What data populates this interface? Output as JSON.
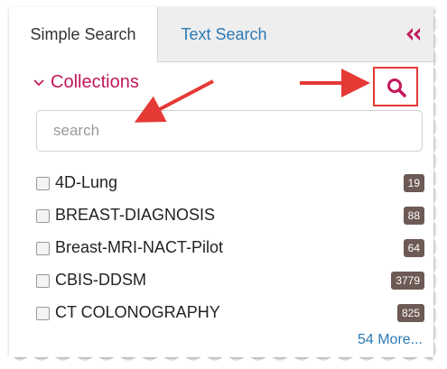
{
  "tabs": {
    "simple_search": "Simple Search",
    "text_search": "Text Search"
  },
  "icons": {
    "collapse": "double-chevron-left-icon",
    "search": "search-icon",
    "chevron": "chevron-down-icon"
  },
  "colors": {
    "accent": "#c2185b",
    "link": "#2a7ab5",
    "annotation": "#e53935",
    "badge": "#6d5a55"
  },
  "collections": {
    "header": "Collections",
    "search_placeholder": "search",
    "items": [
      {
        "name": "4D-Lung",
        "count": "19"
      },
      {
        "name": "BREAST-DIAGNOSIS",
        "count": "88"
      },
      {
        "name": "Breast-MRI-NACT-Pilot",
        "count": "64"
      },
      {
        "name": "CBIS-DDSM",
        "count": "3779"
      },
      {
        "name": "CT COLONOGRAPHY",
        "count": "825"
      }
    ],
    "more_link": "54 More..."
  }
}
